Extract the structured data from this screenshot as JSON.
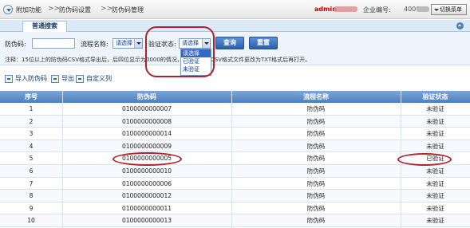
{
  "breadcrumb": [
    "附加功能",
    "防伪码设置",
    "防伪码管理"
  ],
  "breadcrumb_sep": ">>",
  "user": {
    "name": "admin",
    "corp_label": "企业编号:",
    "corp_value": "40000"
  },
  "switch_menu": "切换菜单",
  "search": {
    "tab_label": "普通搜索",
    "code_label": "防伪码:",
    "code_value": "",
    "flow_label": "流程名称:",
    "flow_value": "请选择",
    "verify_label": "验证状态:",
    "verify_value": "请选择",
    "verify_options": [
      "请选择",
      "已验证",
      "未验证"
    ],
    "query_button": "查询",
    "reset_button": "重置",
    "note": "注释：15位以上的防伪码CSV格式导出后，后四位显示为0000的情况，请把导出的CSV格式文件更改为TXT格式后再打开。"
  },
  "toolbar": {
    "import": "导入防伪码",
    "export": "导出",
    "custom_columns": "自定义列"
  },
  "table": {
    "headers": [
      "序号",
      "防伪码",
      "流程名称",
      "验证状态"
    ],
    "rows": [
      [
        "1",
        "0100000000007",
        "防伪码",
        "未验证"
      ],
      [
        "2",
        "0100000000008",
        "防伪码",
        "未验证"
      ],
      [
        "3",
        "0100000000014",
        "防伪码",
        "未验证"
      ],
      [
        "4",
        "0100000000009",
        "防伪码",
        "未验证"
      ],
      [
        "5",
        "0100000000005",
        "防伪码",
        "已验证"
      ],
      [
        "6",
        "0100000000010",
        "防伪码",
        "未验证"
      ],
      [
        "7",
        "0100000000006",
        "防伪码",
        "未验证"
      ],
      [
        "8",
        "0100000000012",
        "防伪码",
        "未验证"
      ],
      [
        "9",
        "0100000000011",
        "防伪码",
        "未验证"
      ],
      [
        "10",
        "0100000000013",
        "防伪码",
        "未验证"
      ]
    ]
  },
  "colors": {
    "header_blue": "#4b7fc1",
    "annotation_red": "#b0232a",
    "admin_red": "#cc0000"
  }
}
